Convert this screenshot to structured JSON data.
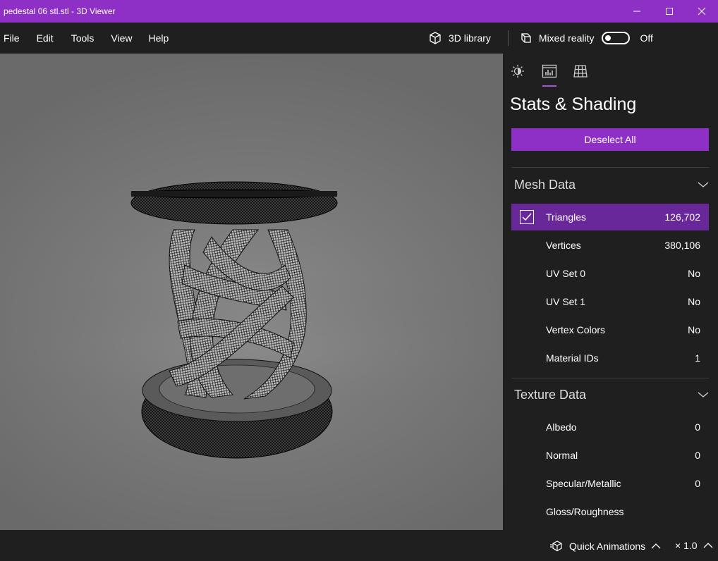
{
  "window": {
    "title": "pedestal 06 stl.stl - 3D Viewer"
  },
  "menu": {
    "items": [
      "File",
      "Edit",
      "Tools",
      "View",
      "Help"
    ]
  },
  "toolbar": {
    "library_label": "3D library",
    "mixed_reality_label": "Mixed reality",
    "mixed_reality_state": "Off"
  },
  "panel": {
    "title": "Stats & Shading",
    "deselect_label": "Deselect All",
    "mesh_section": "Mesh Data",
    "mesh_rows": [
      {
        "name": "Triangles",
        "value": "126,702",
        "checked": true
      },
      {
        "name": "Vertices",
        "value": "380,106"
      },
      {
        "name": "UV Set 0",
        "value": "No"
      },
      {
        "name": "UV Set 1",
        "value": "No"
      },
      {
        "name": "Vertex Colors",
        "value": "No"
      },
      {
        "name": "Material IDs",
        "value": "1"
      }
    ],
    "texture_section": "Texture Data",
    "texture_rows": [
      {
        "name": "Albedo",
        "value": "0"
      },
      {
        "name": "Normal",
        "value": "0"
      },
      {
        "name": "Specular/Metallic",
        "value": "0"
      },
      {
        "name": "Gloss/Roughness",
        "value": ""
      }
    ]
  },
  "statusbar": {
    "quick_animations": "Quick Animations",
    "speed": "× 1.0"
  },
  "colors": {
    "accent": "#8e2fc6",
    "selected": "#68289a",
    "background": "#1f1f1f"
  }
}
